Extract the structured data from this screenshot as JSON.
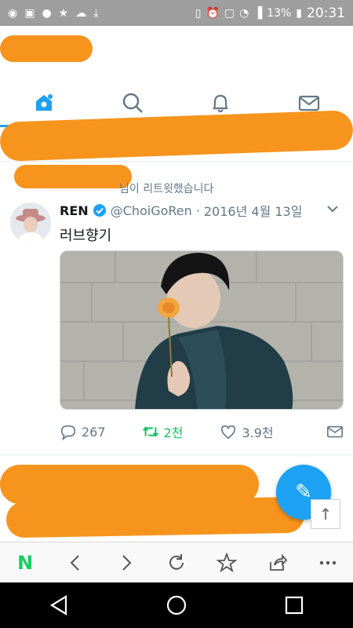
{
  "status_bar": {
    "left_icons": [
      "g-icon",
      "gallery-icon",
      "messenger-icon",
      "star-icon",
      "cloud-icon",
      "download-icon"
    ],
    "battery": "13%",
    "time": "20:31"
  },
  "tabs": [
    {
      "name": "home",
      "active": true
    },
    {
      "name": "search",
      "active": false
    },
    {
      "name": "notifications",
      "active": false
    },
    {
      "name": "messages",
      "active": false
    }
  ],
  "retweet_note": "님이 리트윗했습니다",
  "tweet": {
    "name": "REN",
    "handle": "@ChoiGoRen",
    "separator": "·",
    "date": "2016년 4월 13일",
    "text": "러브향기",
    "reply_count": "267",
    "retweet_count": "2천",
    "like_count": "3.9천"
  },
  "colors": {
    "accent": "#1da1f2",
    "retweet": "#17bf63",
    "muted": "#657786",
    "redaction": "#f7941d"
  }
}
